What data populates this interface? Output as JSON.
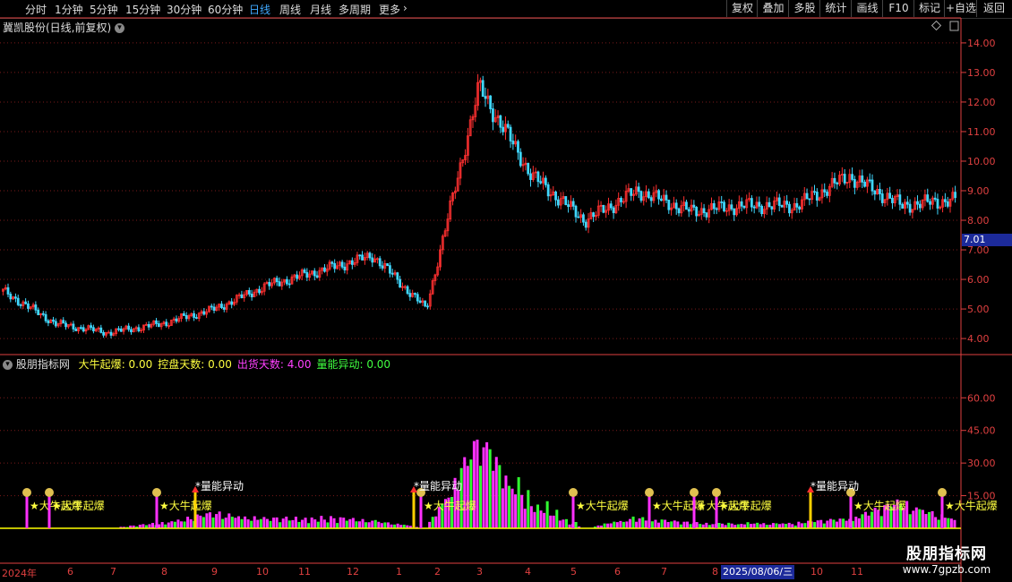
{
  "toolbar": {
    "periods": [
      "分时",
      "1分钟",
      "5分钟",
      "15分钟",
      "30分钟",
      "60分钟",
      "日线",
      "周线",
      "月线",
      "多周期",
      "更多"
    ],
    "active_period": "日线",
    "more_icon": "chevron-right-icon",
    "buttons": [
      "复权",
      "叠加",
      "多股",
      "统计",
      "画线",
      "F10",
      "标记",
      "+自选",
      "返回"
    ]
  },
  "price_panel": {
    "title": "冀凯股份(日线,前复权)",
    "title_icon": "chevron-down-icon",
    "corner_icons": [
      "diamond-icon",
      "square-icon"
    ],
    "current_price_tag": "7.01",
    "axis_labels": [
      "14.00",
      "13.00",
      "12.00",
      "11.00",
      "10.00",
      "9.00",
      "8.00",
      "7.00",
      "6.00",
      "5.00",
      "4.00"
    ]
  },
  "indicator_panel": {
    "title": "股朋指标网",
    "title_icon": "chevron-down-icon",
    "fields": [
      {
        "label": "大牛起爆",
        "value": "0.00",
        "color": "#ffff40"
      },
      {
        "label": "控盘天数",
        "value": "0.00",
        "color": "#ffff40"
      },
      {
        "label": "出货天数",
        "value": "4.00",
        "color": "#ff40ff"
      },
      {
        "label": "量能异动",
        "value": "0.00",
        "color": "#40ff40"
      }
    ],
    "axis_labels": [
      "60.00",
      "45.00",
      "30.00",
      "15.00"
    ],
    "signal_bull": "★大牛起爆",
    "signal_volume": "*量能异动"
  },
  "time_axis": {
    "months": [
      "2024年",
      "6",
      "7",
      "8",
      "9",
      "10",
      "11",
      "12",
      "1",
      "2",
      "3",
      "4",
      "5",
      "6",
      "7",
      "8",
      "9",
      "10",
      "11"
    ],
    "cursor_date": "2025/08/06/三"
  },
  "watermark": {
    "title": "股朋指标网",
    "url": "www.7gpzb.com"
  },
  "colors": {
    "up": "#ff3030",
    "down": "#40d8ff",
    "control": "#ff30ff",
    "volume": "#30ff30",
    "baseline": "#ffff00",
    "grid": "#7a1a1a",
    "axis": "#e04040"
  },
  "chart_data": [
    {
      "type": "candlestick",
      "title": "冀凯股份(日线,前复权)",
      "ylim": [
        3.7,
        14.3
      ],
      "x": [
        "2024-05",
        "2024-06",
        "2024-07",
        "2024-08",
        "2024-09",
        "2024-10",
        "2024-11",
        "2024-12",
        "2025-01",
        "2025-02",
        "2025-03",
        "2025-04",
        "2025-05",
        "2025-06",
        "2025-07",
        "2025-08",
        "2025-09",
        "2025-10",
        "2025-11"
      ],
      "close_approx": [
        5.6,
        4.5,
        4.2,
        4.5,
        5.0,
        5.8,
        6.3,
        6.8,
        5.0,
        12.5,
        9.5,
        8.0,
        9.0,
        8.3,
        8.5,
        8.5,
        9.5,
        8.5,
        8.7
      ],
      "last_price": 7.01
    },
    {
      "type": "bar",
      "title": "股朋指标网",
      "ylim": [
        0,
        70
      ],
      "series": [
        {
          "name": "控盘天数",
          "values": [
            0,
            0,
            0,
            3,
            8,
            5,
            6,
            4,
            0,
            45,
            10,
            0,
            5,
            3,
            2,
            3,
            5,
            14,
            4
          ]
        },
        {
          "name": "量能异动",
          "values": [
            0,
            0,
            0,
            2,
            6,
            4,
            3,
            4,
            0,
            42,
            18,
            0,
            6,
            2,
            3,
            2,
            5,
            12,
            4
          ]
        }
      ]
    }
  ]
}
